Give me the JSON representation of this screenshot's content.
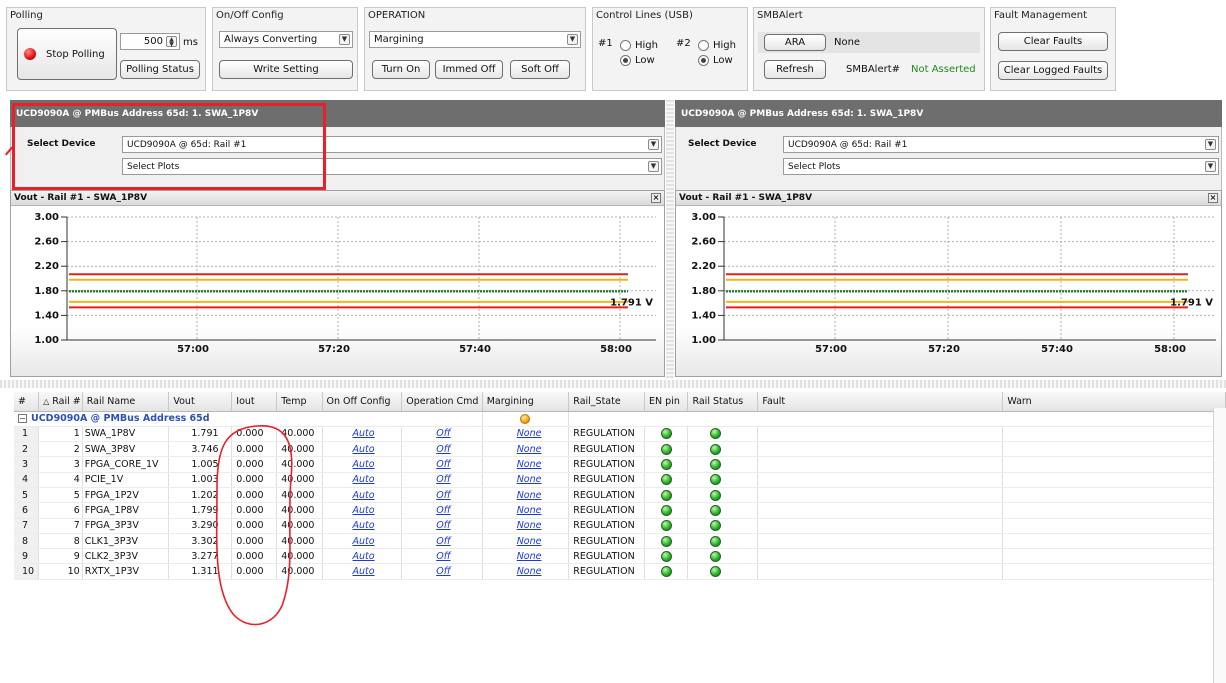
{
  "polling": {
    "title": "Polling",
    "stop_label": "Stop Polling",
    "interval": "500",
    "unit": "ms",
    "status_label": "Polling Status"
  },
  "onoff": {
    "title": "On/Off Config",
    "selected": "Always Converting",
    "write_label": "Write Setting"
  },
  "operation": {
    "title": "OPERATION",
    "selected": "Margining",
    "turn_on": "Turn On",
    "immed_off": "Immed Off",
    "soft_off": "Soft Off"
  },
  "control_lines": {
    "title": "Control Lines (USB)",
    "line1": "#1",
    "line2": "#2",
    "high": "High",
    "low": "Low"
  },
  "smbalert": {
    "title": "SMBAlert",
    "ara_label": "ARA",
    "ara_value": "None",
    "refresh_label": "Refresh",
    "alert_label": "SMBAlert#",
    "alert_value": "Not Asserted",
    "status_color": "#1f8b1f"
  },
  "fault_mgmt": {
    "title": "Fault Management",
    "clear_label": "Clear Faults",
    "clear_logged_label": "Clear Logged Faults"
  },
  "panels": [
    {
      "header": "UCD9090A @ PMBus Address 65d: 1. SWA_1P8V",
      "select_label": "Select Device",
      "device": "UCD9090A @ 65d: Rail #1",
      "plots": "Select Plots",
      "chart_title": "Vout - Rail #1 - SWA_1P8V",
      "value_label": "1.791 V"
    },
    {
      "header": "UCD9090A @ PMBus Address 65d: 1. SWA_1P8V",
      "select_label": "Select Device",
      "device": "UCD9090A @ 65d: Rail #1",
      "plots": "Select Plots",
      "chart_title": "Vout - Rail #1 - SWA_1P8V",
      "value_label": "1.791 V"
    }
  ],
  "chart_data": [
    {
      "type": "line",
      "title": "Vout - Rail #1 - SWA_1P8V",
      "y_ticks": [
        "3.00",
        "2.60",
        "2.20",
        "1.80",
        "1.40",
        "1.00"
      ],
      "x_ticks": [
        "57:00",
        "57:20",
        "57:40",
        "58:00"
      ],
      "ylim": [
        1.0,
        3.0
      ],
      "series": [
        {
          "color": "#e2231a",
          "values": [
            2.07,
            2.07
          ]
        },
        {
          "color": "#f6b21b",
          "values": [
            1.98,
            1.98
          ]
        },
        {
          "color": "#2a7d2a",
          "values": [
            1.791,
            1.791
          ]
        },
        {
          "color": "#f6b21b",
          "values": [
            1.62,
            1.62
          ]
        },
        {
          "color": "#e2231a",
          "values": [
            1.53,
            1.53
          ]
        }
      ],
      "annotation": "1.791 V"
    },
    {
      "type": "line",
      "title": "Vout - Rail #1 - SWA_1P8V",
      "y_ticks": [
        "3.00",
        "2.60",
        "2.20",
        "1.80",
        "1.40",
        "1.00"
      ],
      "x_ticks": [
        "57:00",
        "57:20",
        "57:40",
        "58:00"
      ],
      "ylim": [
        1.0,
        3.0
      ],
      "series": [
        {
          "color": "#e2231a",
          "values": [
            2.07,
            2.07
          ]
        },
        {
          "color": "#f6b21b",
          "values": [
            1.98,
            1.98
          ]
        },
        {
          "color": "#2a7d2a",
          "values": [
            1.791,
            1.791
          ]
        },
        {
          "color": "#f6b21b",
          "values": [
            1.62,
            1.62
          ]
        },
        {
          "color": "#e2231a",
          "values": [
            1.53,
            1.53
          ]
        }
      ],
      "annotation": "1.791 V"
    }
  ],
  "table": {
    "headers": [
      "#",
      "Rail #",
      "Rail Name",
      "Vout",
      "Iout",
      "Temp",
      "On Off Config",
      "Operation Cmd",
      "Margining",
      "Rail_State",
      "EN pin",
      "Rail Status",
      "Fault",
      "Warn"
    ],
    "group_label": "UCD9090A @ PMBus Address 65d",
    "rows": [
      {
        "idx": "1",
        "rail": "1",
        "name": "SWA_1P8V",
        "vout": "1.791",
        "iout": "0.000",
        "temp": "40.000",
        "onoff": "Auto",
        "opcmd": "Off",
        "margin": "None",
        "state": "REGULATION"
      },
      {
        "idx": "2",
        "rail": "2",
        "name": "SWA_3P8V",
        "vout": "3.746",
        "iout": "0.000",
        "temp": "40.000",
        "onoff": "Auto",
        "opcmd": "Off",
        "margin": "None",
        "state": "REGULATION"
      },
      {
        "idx": "3",
        "rail": "3",
        "name": "FPGA_CORE_1V",
        "vout": "1.005",
        "iout": "0.000",
        "temp": "40.000",
        "onoff": "Auto",
        "opcmd": "Off",
        "margin": "None",
        "state": "REGULATION"
      },
      {
        "idx": "4",
        "rail": "4",
        "name": "PCIE_1V",
        "vout": "1.003",
        "iout": "0.000",
        "temp": "40.000",
        "onoff": "Auto",
        "opcmd": "Off",
        "margin": "None",
        "state": "REGULATION"
      },
      {
        "idx": "5",
        "rail": "5",
        "name": "FPGA_1P2V",
        "vout": "1.202",
        "iout": "0.000",
        "temp": "40.000",
        "onoff": "Auto",
        "opcmd": "Off",
        "margin": "None",
        "state": "REGULATION"
      },
      {
        "idx": "6",
        "rail": "6",
        "name": "FPGA_1P8V",
        "vout": "1.799",
        "iout": "0.000",
        "temp": "40.000",
        "onoff": "Auto",
        "opcmd": "Off",
        "margin": "None",
        "state": "REGULATION"
      },
      {
        "idx": "7",
        "rail": "7",
        "name": "FPGA_3P3V",
        "vout": "3.290",
        "iout": "0.000",
        "temp": "40.000",
        "onoff": "Auto",
        "opcmd": "Off",
        "margin": "None",
        "state": "REGULATION"
      },
      {
        "idx": "8",
        "rail": "8",
        "name": "CLK1_3P3V",
        "vout": "3.302",
        "iout": "0.000",
        "temp": "40.000",
        "onoff": "Auto",
        "opcmd": "Off",
        "margin": "None",
        "state": "REGULATION"
      },
      {
        "idx": "9",
        "rail": "9",
        "name": "CLK2_3P3V",
        "vout": "3.277",
        "iout": "0.000",
        "temp": "40.000",
        "onoff": "Auto",
        "opcmd": "Off",
        "margin": "None",
        "state": "REGULATION"
      },
      {
        "idx": "10",
        "rail": "10",
        "name": "RXTX_1P3V",
        "vout": "1.311",
        "iout": "0.000",
        "temp": "40.000",
        "onoff": "Auto",
        "opcmd": "Off",
        "margin": "None",
        "state": "REGULATION"
      }
    ]
  },
  "annotation_color": "#e8202a"
}
